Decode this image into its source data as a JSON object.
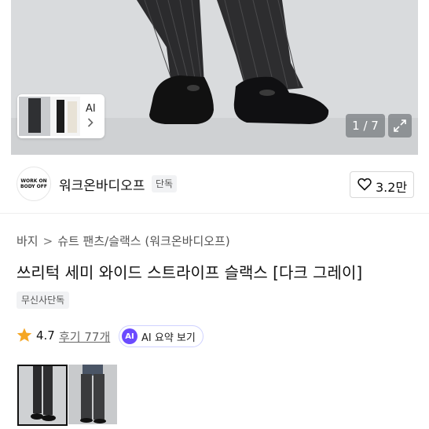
{
  "gallery": {
    "ai_label": "AI",
    "counter": "1 / 7"
  },
  "brand": {
    "logo_text": "WORK ON BODY OFF",
    "name": "워크온바디오프",
    "exclusive_badge": "단독",
    "likes": "3.2만"
  },
  "breadcrumb": {
    "category": "바지",
    "subcategory": "슈트 팬츠/슬랙스",
    "brand": "(워크온바디오프)"
  },
  "product": {
    "title": "쓰리턱 세미 와이드 스트라이프 슬랙스 [다크 그레이]",
    "tag": "무신사단독",
    "rating": "4.7",
    "reviews": "후기 77개",
    "ai_summary_icon": "AI",
    "ai_summary_label": "AI 요약 보기"
  },
  "icons": {
    "heart": "heart-icon",
    "star": "star-icon",
    "expand": "expand-icon",
    "chevron": "chevron-right-icon"
  },
  "colors": {
    "ai_accent": "#6b4bff",
    "star": "#f5a623"
  }
}
